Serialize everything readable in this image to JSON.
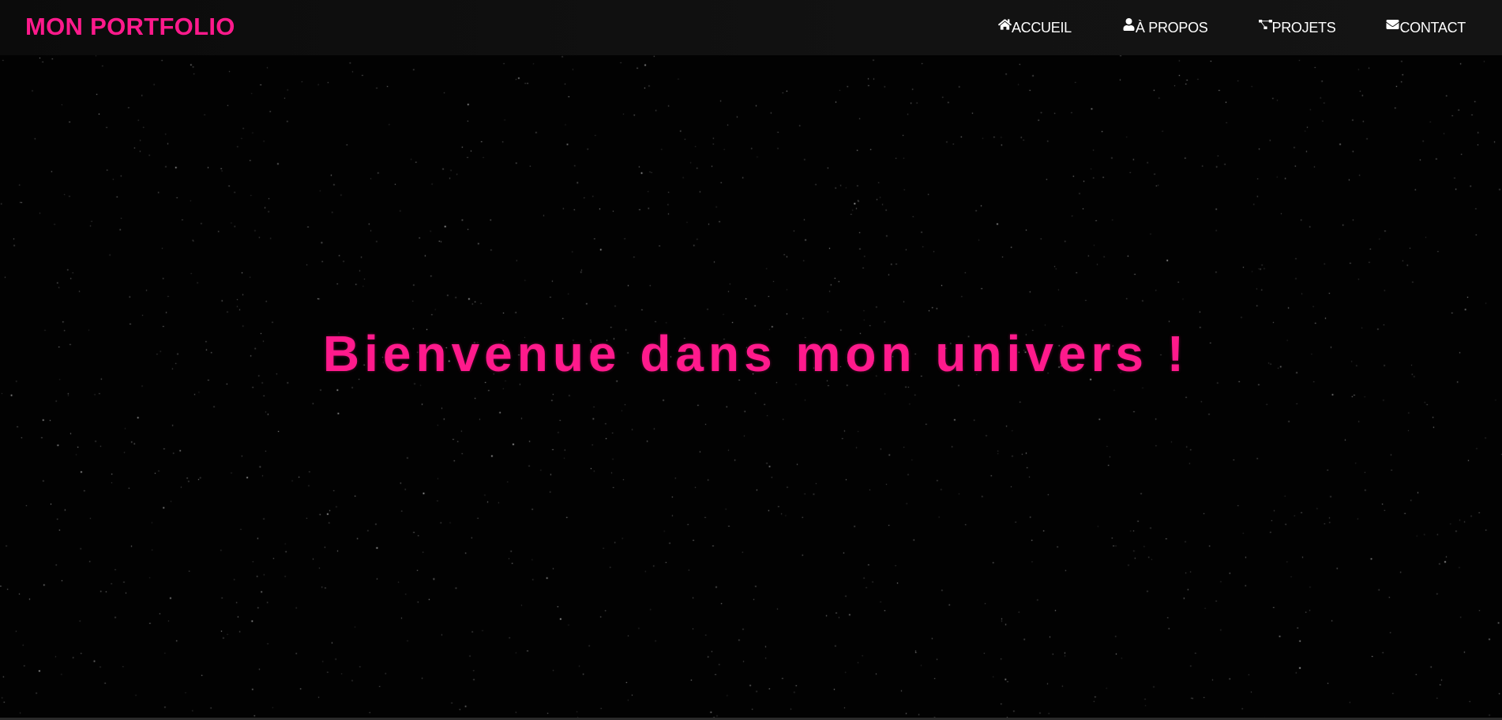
{
  "header": {
    "logo": "MON PORTFOLIO",
    "nav": [
      {
        "label": "ACCUEIL",
        "icon": "home-icon"
      },
      {
        "label": "À PROPOS",
        "icon": "user-icon"
      },
      {
        "label": "PROJETS",
        "icon": "project-diagram-icon"
      },
      {
        "label": "CONTACT",
        "icon": "envelope-icon"
      }
    ]
  },
  "hero": {
    "title": "Bienvenue dans mon univers !"
  },
  "colors": {
    "accent": "#ff1a8c",
    "background": "#020202",
    "navbar": "#111111",
    "nav_text": "#ffffff"
  }
}
